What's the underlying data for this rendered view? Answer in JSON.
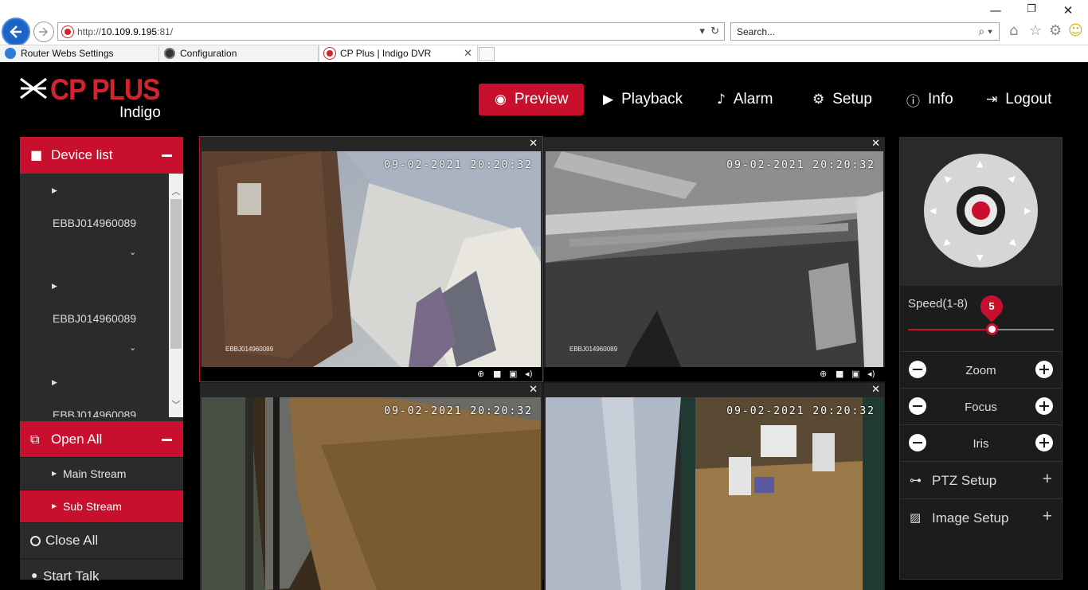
{
  "browser": {
    "url_prefix": "http://",
    "url_host": "10.109.9.195",
    "url_suffix": ":81/",
    "search_placeholder": "Search...",
    "tabs": [
      {
        "label": "Router Webs Settings",
        "icon": "ie-icon"
      },
      {
        "label": "Configuration",
        "icon": "globe-icon"
      },
      {
        "label": "CP Plus | Indigo DVR",
        "icon": "cpplus-icon"
      }
    ],
    "tab_close": "✕"
  },
  "app": {
    "brand": "CP PLUS",
    "brand_sub": "Indigo",
    "brand_color": "#d4232d",
    "nav": [
      {
        "label": "Preview",
        "icon": "eye-icon",
        "active": true
      },
      {
        "label": "Playback",
        "icon": "play-icon"
      },
      {
        "label": "Alarm",
        "icon": "bell-icon"
      },
      {
        "label": "Setup",
        "icon": "gear-icon"
      },
      {
        "label": "Info",
        "icon": "info-icon"
      },
      {
        "label": "Logout",
        "icon": "logout-icon"
      }
    ]
  },
  "sidebar": {
    "device_list_title": "Device list",
    "devices": [
      "EBBJ014960089",
      "EBBJ014960089",
      "EBBJ014960089"
    ],
    "open_all_title": "Open All",
    "streams": [
      {
        "label": "Main Stream",
        "selected": false
      },
      {
        "label": "Sub Stream",
        "selected": true
      }
    ],
    "close_all": "Close All",
    "start_talk": "Start Talk"
  },
  "grid": {
    "cells": [
      {
        "timestamp": "09-02-2021 20:20:32",
        "camera": "EBBJ014960089",
        "selected": true
      },
      {
        "timestamp": "09-02-2021 20:20:32",
        "camera": "EBBJ014960089",
        "selected": false
      },
      {
        "timestamp": "09-02-2021 20:20:32",
        "camera": "",
        "selected": false
      },
      {
        "timestamp": "09-02-2021 20:20:32",
        "camera": "",
        "selected": false
      }
    ]
  },
  "ptz": {
    "speed_label": "Speed(1-8)",
    "speed_value": "5",
    "speed_min": 1,
    "speed_max": 8,
    "lens": [
      {
        "label": "Zoom"
      },
      {
        "label": "Focus"
      },
      {
        "label": "Iris"
      }
    ],
    "ptz_setup": "PTZ Setup",
    "image_setup": "Image Setup"
  }
}
